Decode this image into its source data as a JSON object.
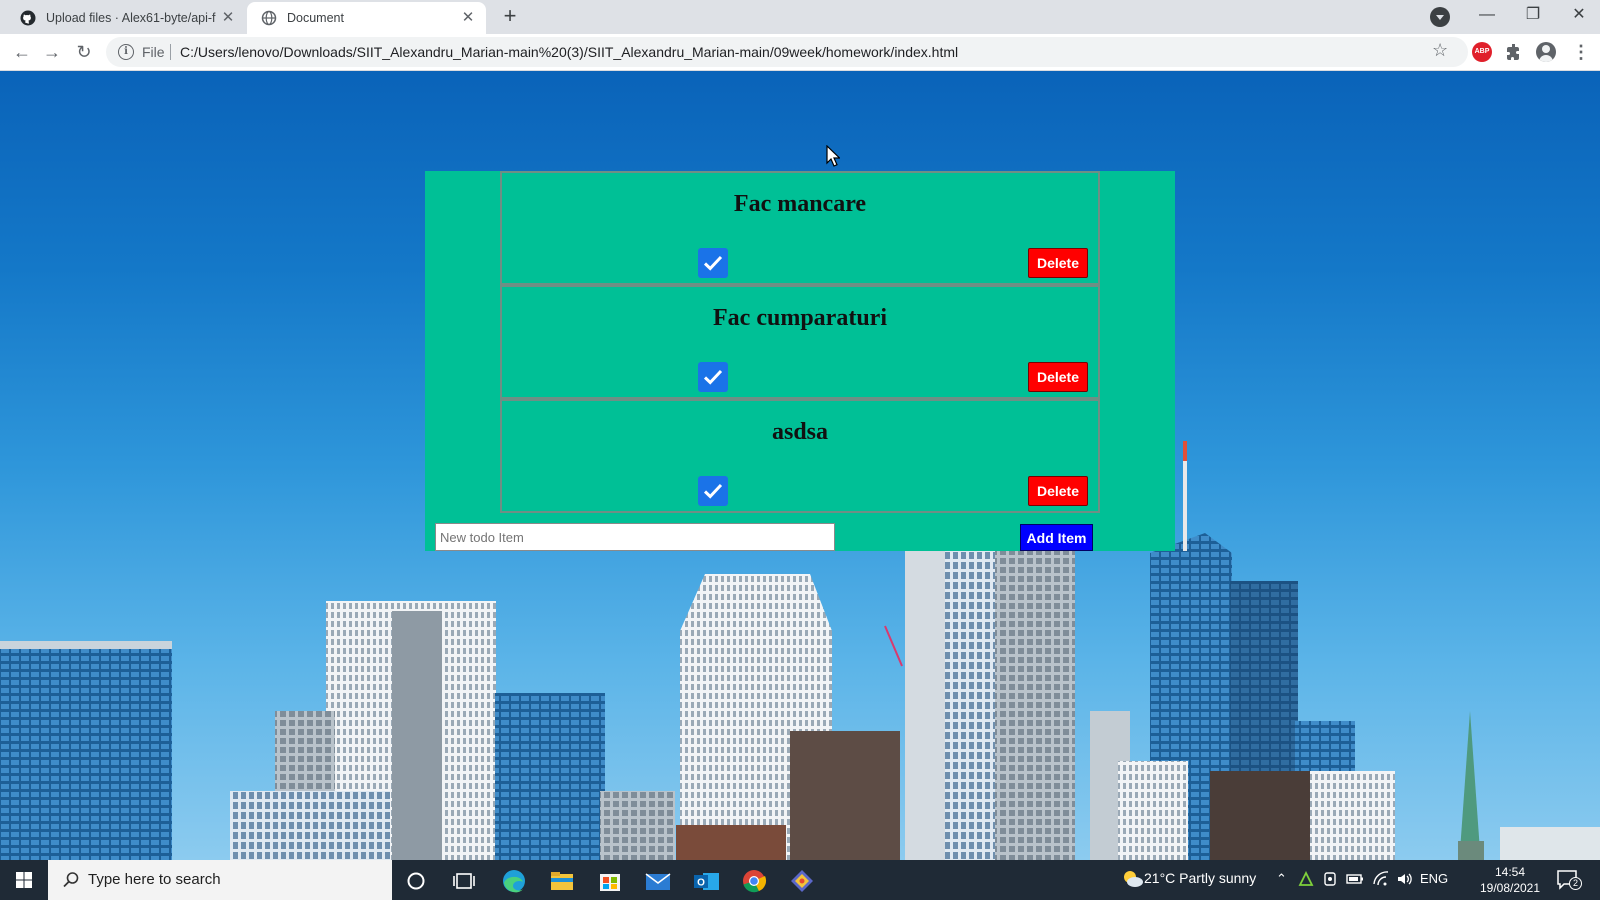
{
  "browser": {
    "tabs": [
      {
        "title": "Upload files · Alex61-byte/api-fet",
        "icon": "github-icon",
        "active": false
      },
      {
        "title": "Document",
        "icon": "globe-icon",
        "active": true
      }
    ],
    "address": {
      "scheme_label": "File",
      "url": "C:/Users/lenovo/Downloads/SIIT_Alexandru_Marian-main%20(3)/SIIT_Alexandru_Marian-main/09week/homework/index.html"
    },
    "extension_label": "ABP"
  },
  "todo": {
    "items": [
      {
        "title": "Fac mancare",
        "checked": true,
        "delete_label": "Delete"
      },
      {
        "title": "Fac cumparaturi",
        "checked": true,
        "delete_label": "Delete"
      },
      {
        "title": "asdsa",
        "checked": true,
        "delete_label": "Delete"
      }
    ],
    "input_placeholder": "New todo Item",
    "input_value": "",
    "add_label": "Add Item",
    "colors": {
      "panel": "#00c096",
      "delete": "#ff0000",
      "add": "#0000ff",
      "checkbox": "#1a73e8"
    }
  },
  "taskbar": {
    "search_placeholder": "Type here to search",
    "weather": "21°C  Partly sunny",
    "language": "ENG",
    "time": "14:54",
    "date": "19/08/2021",
    "notification_count": "2"
  }
}
